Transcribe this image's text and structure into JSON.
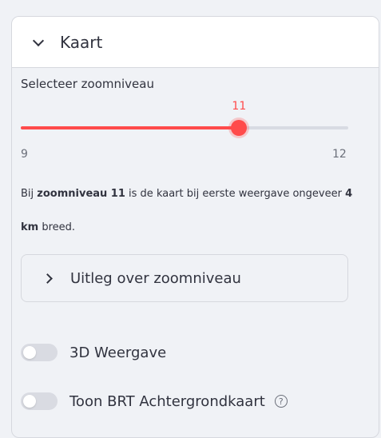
{
  "panel": {
    "title": "Kaart"
  },
  "slider": {
    "label": "Selecteer zoomniveau",
    "value": 11,
    "min": 9,
    "max": 12,
    "accent_color": "#ff4b4b"
  },
  "info": {
    "prefix": "Bij ",
    "bold_zoom": "zoomniveau 11",
    "middle": " is de kaart bij eerste weergave ongeveer ",
    "bold_distance": "4 km",
    "suffix": " breed."
  },
  "expander": {
    "label": "Uitleg over zoomniveau"
  },
  "toggles": [
    {
      "label": "3D Weergave",
      "checked": false
    },
    {
      "label": "Toon BRT Achtergrondkaart",
      "checked": false,
      "help_icon": "question-circle-icon",
      "help_text": "?"
    }
  ]
}
